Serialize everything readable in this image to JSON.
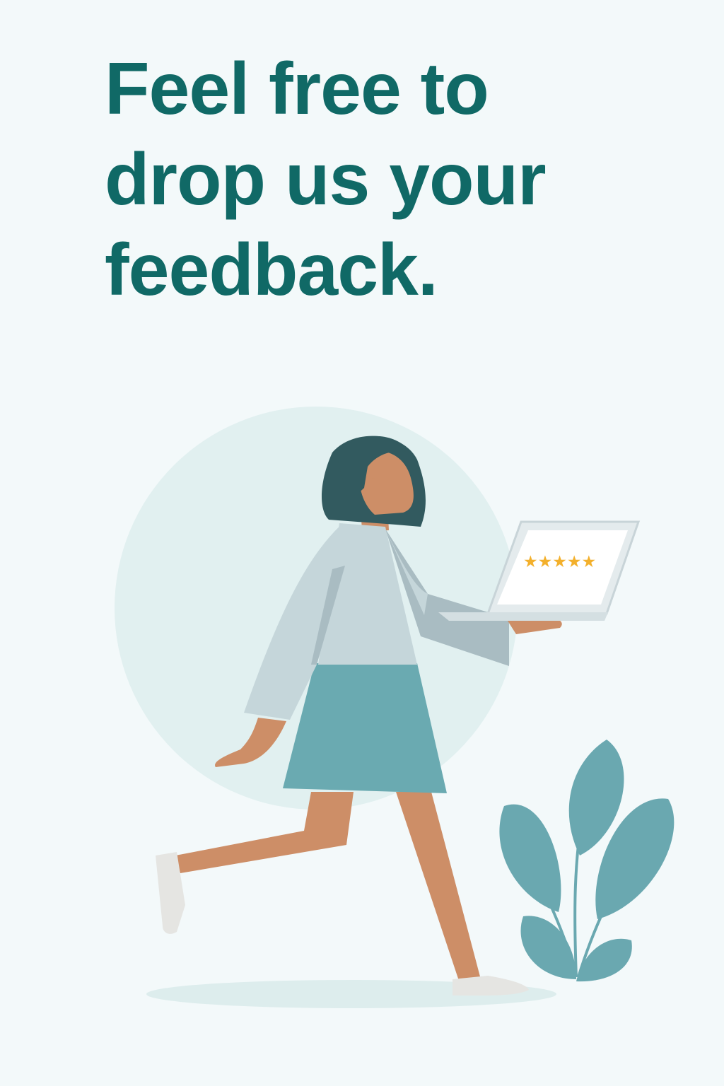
{
  "headline": {
    "line1": "Feel free to",
    "line2": "drop us your",
    "line3": "feedback."
  },
  "illustration": {
    "rating": {
      "stars_filled": 5,
      "stars_total": 5,
      "glyphs": "★★★★★"
    },
    "icons": [
      "woman-figure",
      "laptop-icon",
      "star-icon",
      "plant-icon"
    ]
  },
  "colors": {
    "background": "#f3f9fa",
    "headline": "#106966",
    "circle": "#e1f0f0",
    "hair": "#325a5f",
    "skin": "#cd8e67",
    "top": "#c5d6da",
    "sleeve_shadow": "#a9bcc2",
    "skirt": "#6aaab1",
    "shoe": "#e5e5e2",
    "laptop_body": "#e4ebed",
    "laptop_screen": "#ffffff",
    "star": "#f3b02c",
    "plant": "#6aa8b0",
    "ground_shadow": "#ddeded"
  }
}
